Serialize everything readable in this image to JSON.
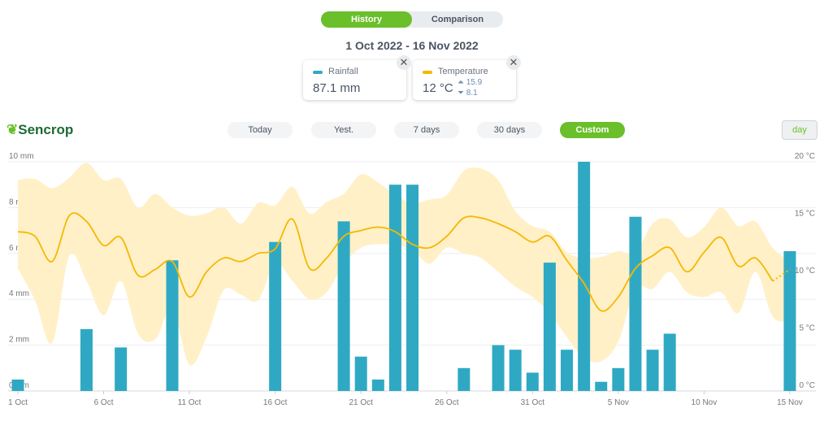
{
  "tabs": [
    {
      "label": "History",
      "active": true
    },
    {
      "label": "Comparison",
      "active": false
    }
  ],
  "date_range": "1 Oct 2022 - 16 Nov 2022",
  "cards": {
    "rainfall": {
      "label": "Rainfall",
      "value": "87.1 mm",
      "color": "#2fa9c3",
      "close": "✕"
    },
    "temperature": {
      "label": "Temperature",
      "value": "12 °C",
      "max": "15.9",
      "min": "8.1",
      "color": "#f5b800",
      "close": "✕"
    }
  },
  "brand": "Sencrop",
  "periods": [
    {
      "label": "Today"
    },
    {
      "label": "Yest."
    },
    {
      "label": "7 days"
    },
    {
      "label": "30 days"
    },
    {
      "label": "Custom",
      "active": true
    }
  ],
  "granularity": "day",
  "chart_data": {
    "type": "bar+line+area",
    "x_start": "2022-10-01",
    "y_left": {
      "unit": "mm",
      "range": [
        0,
        10
      ],
      "ticks": [
        "0 mm",
        "2 mm",
        "4 mm",
        "6 mm",
        "8 mm",
        "10 mm"
      ]
    },
    "y_right": {
      "unit": "°C",
      "range": [
        0,
        20
      ],
      "ticks": [
        "0 °C",
        "5 °C",
        "10 °C",
        "15 °C",
        "20 °C"
      ]
    },
    "x_ticks": [
      "1 Oct",
      "6 Oct",
      "11 Oct",
      "16 Oct",
      "21 Oct",
      "26 Oct",
      "31 Oct",
      "5 Nov",
      "10 Nov",
      "15 Nov"
    ],
    "grid": true,
    "rainfall_mm": {
      "dates": [
        "1 Oct",
        "5 Oct",
        "7 Oct",
        "10 Oct",
        "16 Oct",
        "20 Oct",
        "21 Oct",
        "22 Oct",
        "23 Oct",
        "24 Oct",
        "27 Oct",
        "29 Oct",
        "30 Oct",
        "31 Oct",
        "1 Nov",
        "2 Nov",
        "3 Nov",
        "4 Nov",
        "5 Nov",
        "6 Nov",
        "7 Nov",
        "8 Nov",
        "15 Nov"
      ],
      "values": [
        0.5,
        2.7,
        1.9,
        5.7,
        6.5,
        7.4,
        1.5,
        0.5,
        9.0,
        9.0,
        1.0,
        2.0,
        1.8,
        0.8,
        5.6,
        1.8,
        10.0,
        0.4,
        1.0,
        7.6,
        1.8,
        2.5,
        6.1
      ]
    },
    "temperature_avg": [
      13.9,
      13.5,
      11.3,
      15.3,
      14.8,
      12.7,
      13.4,
      10.1,
      10.6,
      11.3,
      8.2,
      10.4,
      11.6,
      11.3,
      12.0,
      12.4,
      15.0,
      10.7,
      11.6,
      13.5,
      14.0,
      14.3,
      13.9,
      12.8,
      12.5,
      13.5,
      15.1,
      15.1,
      14.6,
      13.9,
      13.0,
      13.5,
      11.4,
      9.4,
      7.0,
      8.2,
      10.7,
      11.8,
      12.5,
      10.4,
      12.1,
      13.4,
      10.9,
      11.6,
      9.6,
      10.6
    ],
    "temperature_max": [
      18.4,
      18.5,
      17.7,
      18.6,
      19.9,
      18.4,
      18.5,
      16.0,
      17.2,
      16.0,
      15.3,
      15.5,
      16.0,
      14.6,
      16.4,
      16.2,
      17.8,
      15.5,
      16.5,
      17.2,
      18.9,
      18.2,
      17.1,
      16.4,
      16.7,
      17.1,
      19.2,
      19.4,
      18.4,
      15.7,
      14.4,
      13.9,
      12.1,
      11.6,
      11.7,
      12.2,
      12.1,
      14.6,
      15.0,
      13.4,
      14.3,
      16.0,
      14.4,
      14.8,
      12.5,
      11.3
    ],
    "temperature_min": [
      10.7,
      7.9,
      4.2,
      11.8,
      9.6,
      6.6,
      9.6,
      5.0,
      4.5,
      7.2,
      2.3,
      4.7,
      8.8,
      8.4,
      7.9,
      11.1,
      9.6,
      8.0,
      8.6,
      11.1,
      12.5,
      12.8,
      12.7,
      12.3,
      11.1,
      12.5,
      12.0,
      11.6,
      10.4,
      9.1,
      8.2,
      6.8,
      4.7,
      2.9,
      2.6,
      4.3,
      8.9,
      8.9,
      10.4,
      8.6,
      8.2,
      8.6,
      6.8,
      10.4,
      6.5,
      6.1
    ]
  }
}
